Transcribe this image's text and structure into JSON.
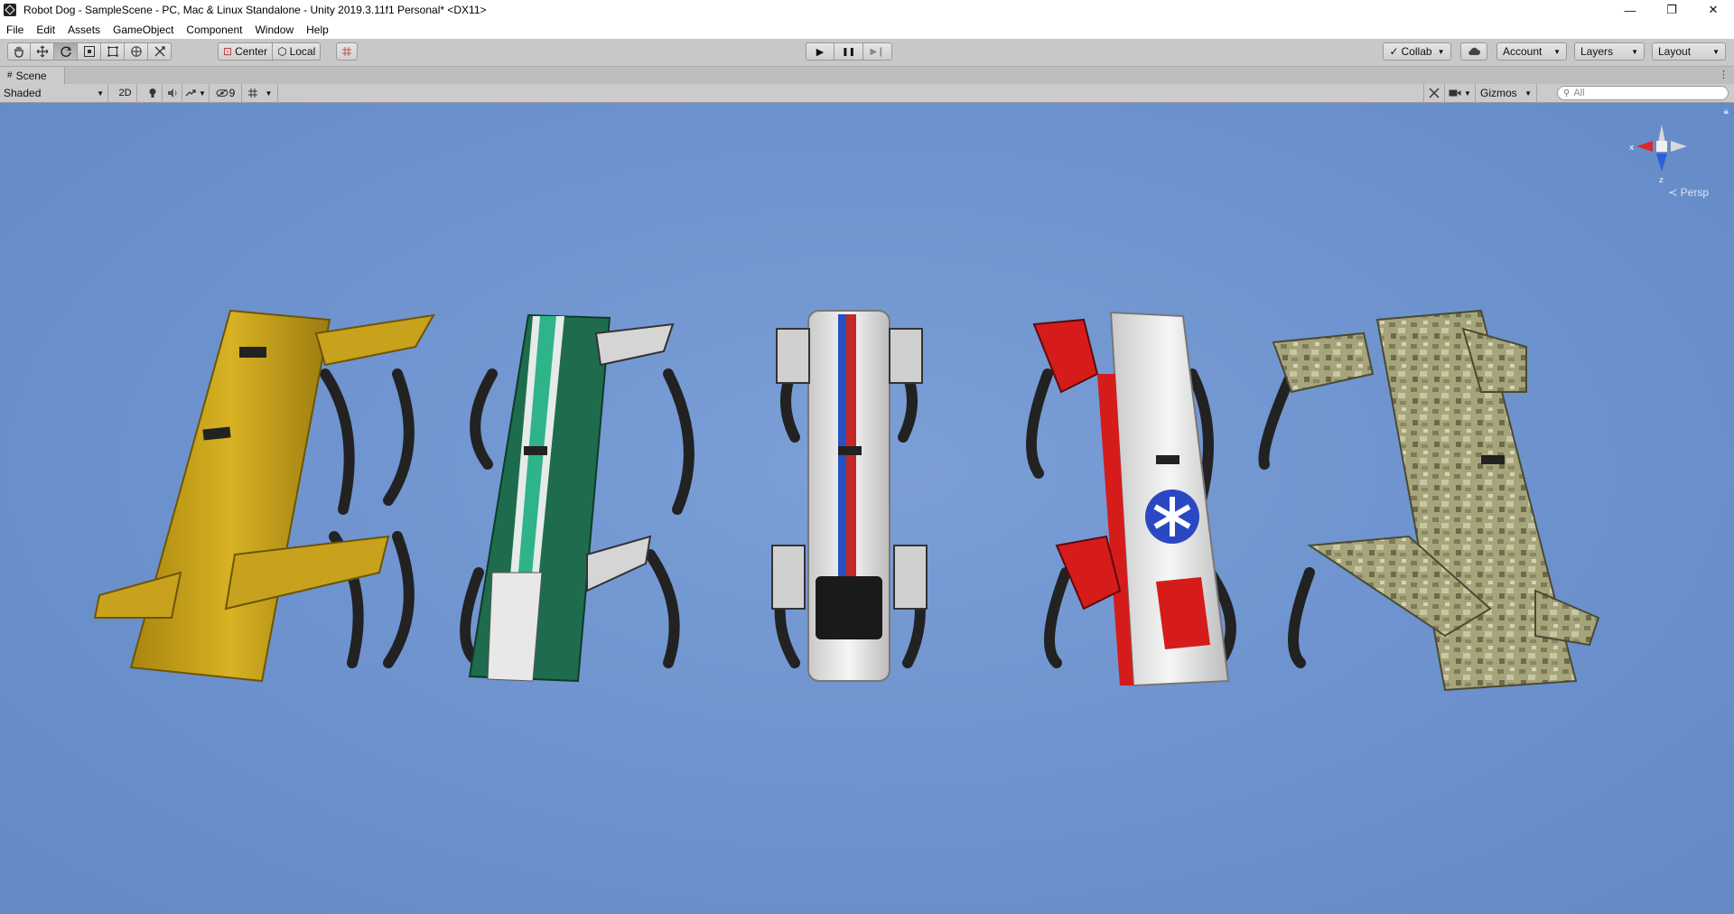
{
  "window": {
    "title": "Robot Dog - SampleScene - PC, Mac & Linux Standalone - Unity 2019.3.11f1 Personal* <DX11>",
    "controls": {
      "minimize": "—",
      "restore": "❐",
      "close": "✕"
    }
  },
  "menu": [
    "File",
    "Edit",
    "Assets",
    "GameObject",
    "Component",
    "Window",
    "Help"
  ],
  "toolbar": {
    "pivot_mode": "Center",
    "pivot_rotation": "Local",
    "play_controls": {
      "play": "▶",
      "pause": "❚❚",
      "step": "▶❙"
    },
    "collab": "Collab",
    "account": "Account",
    "layers": "Layers",
    "layout": "Layout"
  },
  "scene": {
    "tab": "Scene",
    "tab_menu": "⋮",
    "draw_mode": "Shaded",
    "toggle_2d": "2D",
    "hidden_count": "9",
    "gizmos": "Gizmos",
    "search_placeholder": "All",
    "projection": "Persp",
    "axes": {
      "x": "x",
      "z": "z"
    }
  },
  "colors": {
    "viewport_bg": "#6f94cf",
    "robot_yellow": "#c9a21a",
    "robot_green": "#1f6b4e",
    "robot_white": "#e8e8e8",
    "robot_red": "#d61b1b",
    "robot_camo": "#9d9a72"
  },
  "icons": [
    "hand-tool-icon",
    "move-tool-icon",
    "rotate-tool-icon",
    "scale-tool-icon",
    "rect-tool-icon",
    "transform-tool-icon",
    "custom-tool-icon",
    "cloud-icon",
    "light-icon",
    "audio-icon",
    "effects-icon",
    "visibility-icon",
    "grid-icon",
    "camera-icon",
    "search-icon",
    "lock-icon"
  ]
}
